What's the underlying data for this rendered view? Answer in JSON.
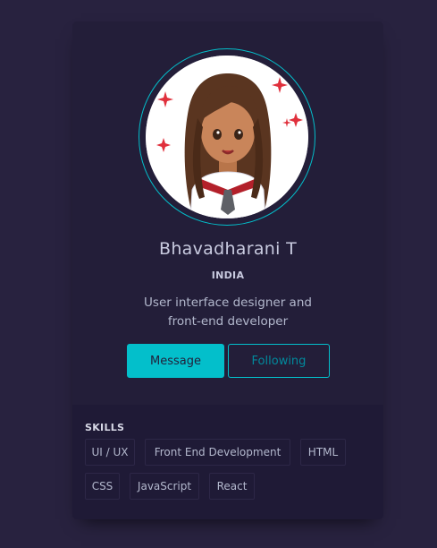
{
  "profile": {
    "name": "Bhavadharani T",
    "country": "INDIA",
    "bio_line1": "User interface designer and",
    "bio_line2": "front-end developer"
  },
  "actions": {
    "message_label": "Message",
    "following_label": "Following"
  },
  "skills": {
    "title": "SKILLS",
    "items": [
      "UI / UX",
      "Front End Development",
      "HTML",
      "CSS",
      "JavaScript",
      "React"
    ]
  },
  "colors": {
    "page_bg": "#28223f",
    "card_bg": "#231e39",
    "accent": "#03bfcb"
  },
  "icons": {
    "avatar": "cartoon-girl-avatar"
  }
}
